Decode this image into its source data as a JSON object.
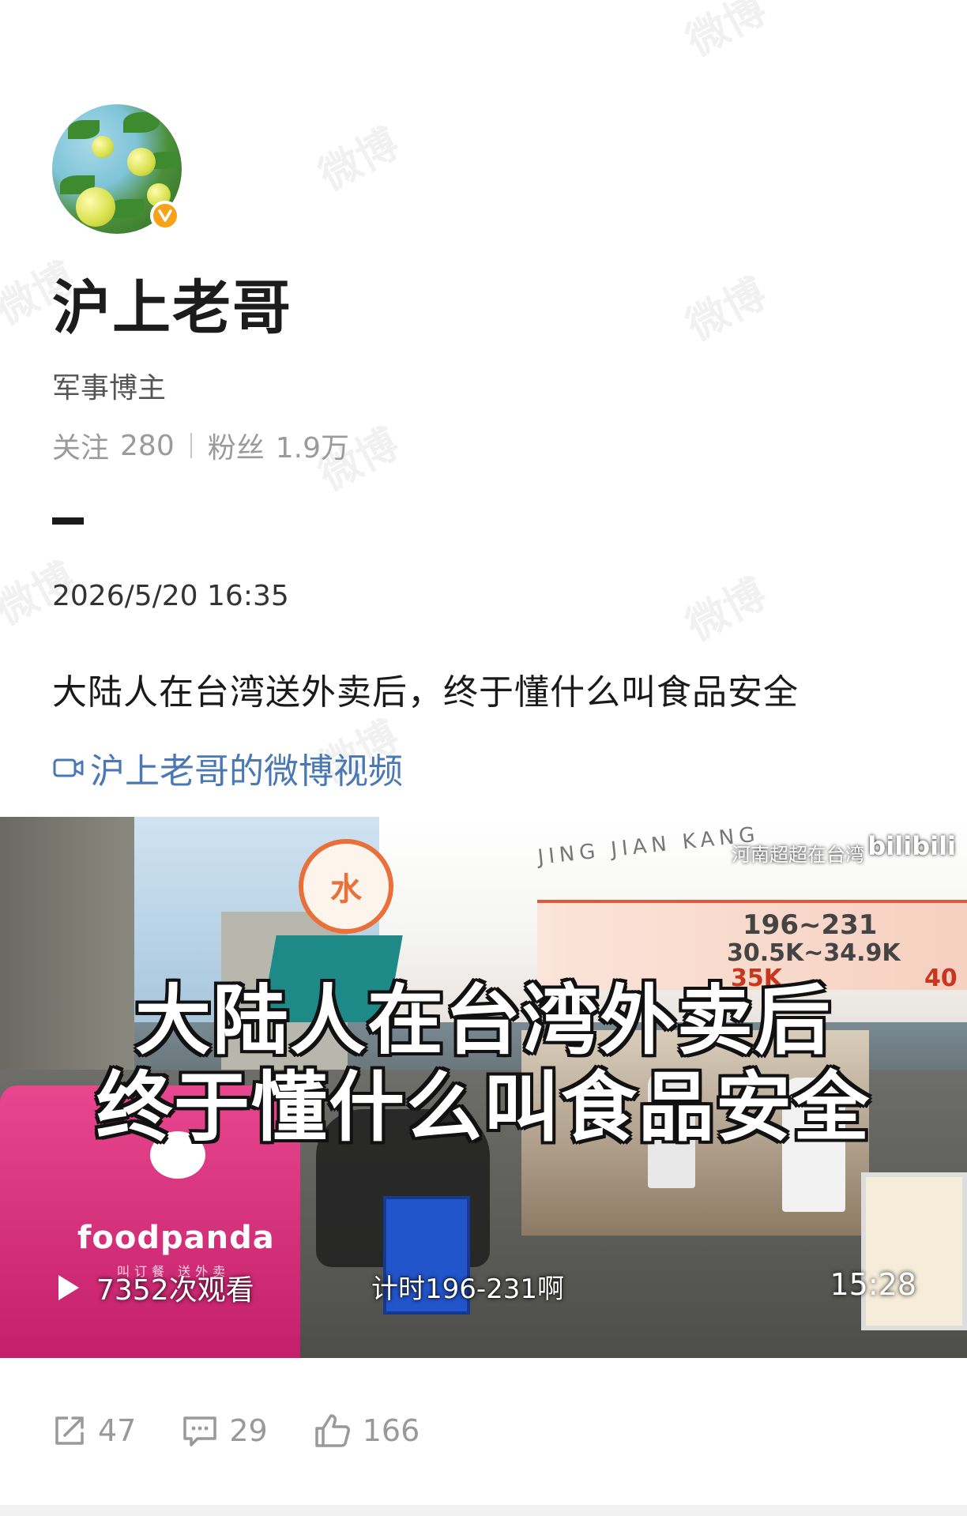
{
  "watermark_text": "微博",
  "profile": {
    "name": "沪上老哥",
    "role": "军事博主",
    "following_label": "关注",
    "following_count": "280",
    "followers_label": "粉丝",
    "followers_count": "1.9万"
  },
  "post": {
    "timestamp": "2026/5/20 16:35",
    "text": "大陆人在台湾送外卖后，终于懂什么叫食品安全",
    "video_link_label": "沪上老哥的微博视频"
  },
  "video": {
    "caption_line1": "大陆人在台湾外卖后",
    "caption_line2": "终于懂什么叫食品安全",
    "uploader_tag": "河南超超在台湾",
    "platform_logo": "bilibili",
    "round_sign": "水",
    "subtitle": "计时196-231啊",
    "views": "7352次观看",
    "duration": "15:28",
    "bag_brand": "foodpanda",
    "bag_sub": "叫订餐 送外卖",
    "sign_header": "JING JIAN KANG",
    "sign_price1": "196~231",
    "sign_price2": "30.5K~34.9K",
    "sign_price3": "35K",
    "sign_price4": "40"
  },
  "actions": {
    "repost_count": "47",
    "comment_count": "29",
    "like_count": "166"
  },
  "colors": {
    "link": "#4a78b5",
    "verified_badge": "#f7a21b",
    "muted": "#999999"
  }
}
